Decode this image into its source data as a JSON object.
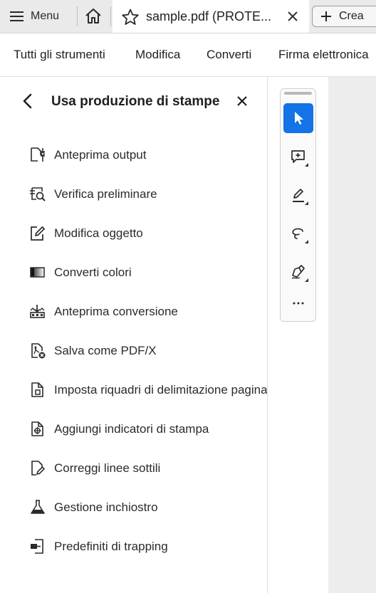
{
  "titlebar": {
    "menu_label": "Menu",
    "tab_title": "sample.pdf (PROTE...",
    "create_label": "Crea"
  },
  "toolsbar": {
    "items": [
      "Tutti gli strumenti",
      "Modifica",
      "Converti",
      "Firma elettronica"
    ]
  },
  "panel": {
    "title": "Usa produzione di stampe",
    "tools": [
      {
        "label": "Anteprima output",
        "icon": "output-preview-icon"
      },
      {
        "label": "Verifica preliminare",
        "icon": "preflight-icon"
      },
      {
        "label": "Modifica oggetto",
        "icon": "edit-object-icon"
      },
      {
        "label": "Converti colori",
        "icon": "convert-colors-icon"
      },
      {
        "label": "Anteprima conversione",
        "icon": "flattener-preview-icon"
      },
      {
        "label": "Salva come PDF/X",
        "icon": "save-pdfx-icon"
      },
      {
        "label": "Imposta riquadri di delimitazione pagina",
        "icon": "page-boxes-icon"
      },
      {
        "label": "Aggiungi indicatori di stampa",
        "icon": "printer-marks-icon"
      },
      {
        "label": "Correggi linee sottili",
        "icon": "fix-hairlines-icon"
      },
      {
        "label": "Gestione inchiostro",
        "icon": "ink-manager-icon"
      },
      {
        "label": "Predefiniti di trapping",
        "icon": "trap-presets-icon"
      }
    ]
  },
  "vtoolbar": {
    "tools": [
      "select-cursor-icon",
      "add-comment-icon",
      "highlight-icon",
      "draw-freeform-icon",
      "sign-icon",
      "more-icon"
    ],
    "more_label": "...",
    "accent": "#1473e6"
  }
}
